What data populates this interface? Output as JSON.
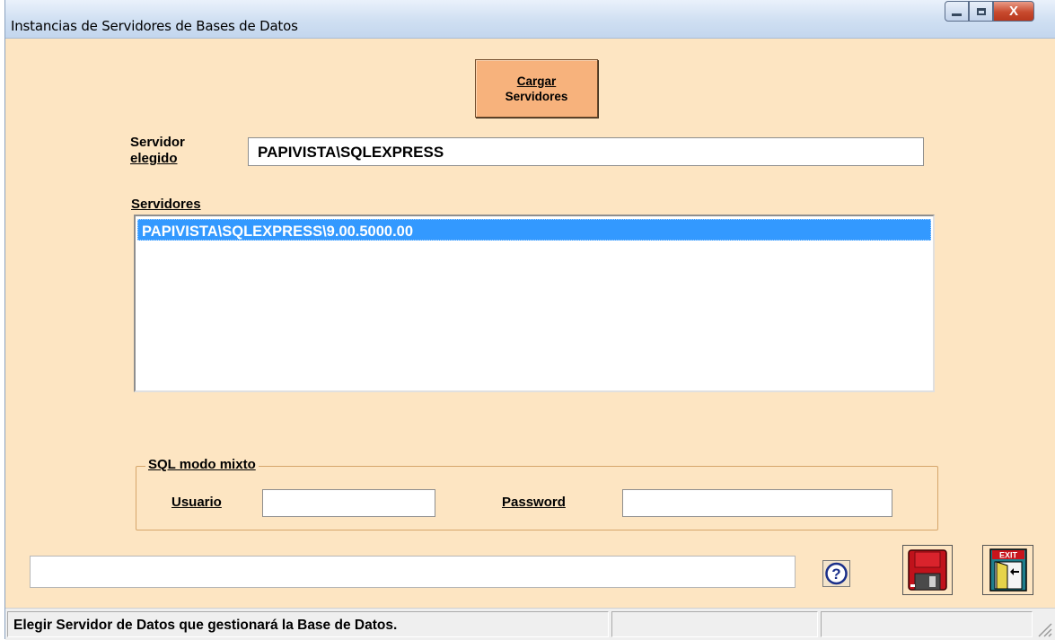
{
  "window": {
    "title": "Instancias de Servidores de Bases de Datos",
    "close_label": "X"
  },
  "toolbar": {
    "load_line1": "Cargar",
    "load_line2": "Servidores"
  },
  "server": {
    "label_line1": "Servidor",
    "label_line2": "elegido",
    "value": "PAPIVISTA\\SQLEXPRESS"
  },
  "servers": {
    "label": "Servidores",
    "items": [
      "PAPIVISTA\\SQLEXPRESS\\9.00.5000.00"
    ],
    "selected_index": 0
  },
  "sql_mixed": {
    "title": "SQL modo mixto",
    "user_label": "Usuario",
    "user_value": "",
    "password_label": "Password",
    "password_value": ""
  },
  "footer": {
    "message_value": "",
    "help_icon": "help-icon",
    "save_icon": "floppy-disk-icon",
    "exit_icon": "exit-door-icon",
    "exit_sign": "EXIT"
  },
  "status": {
    "text": "Elegir Servidor de Datos que gestionará la Base de Datos.",
    "panel2": "",
    "panel3": ""
  },
  "colors": {
    "form_bg": "#fde5c2",
    "button_bg": "#f7b27c",
    "selection": "#3399ff",
    "group_border": "#d6a66b"
  }
}
